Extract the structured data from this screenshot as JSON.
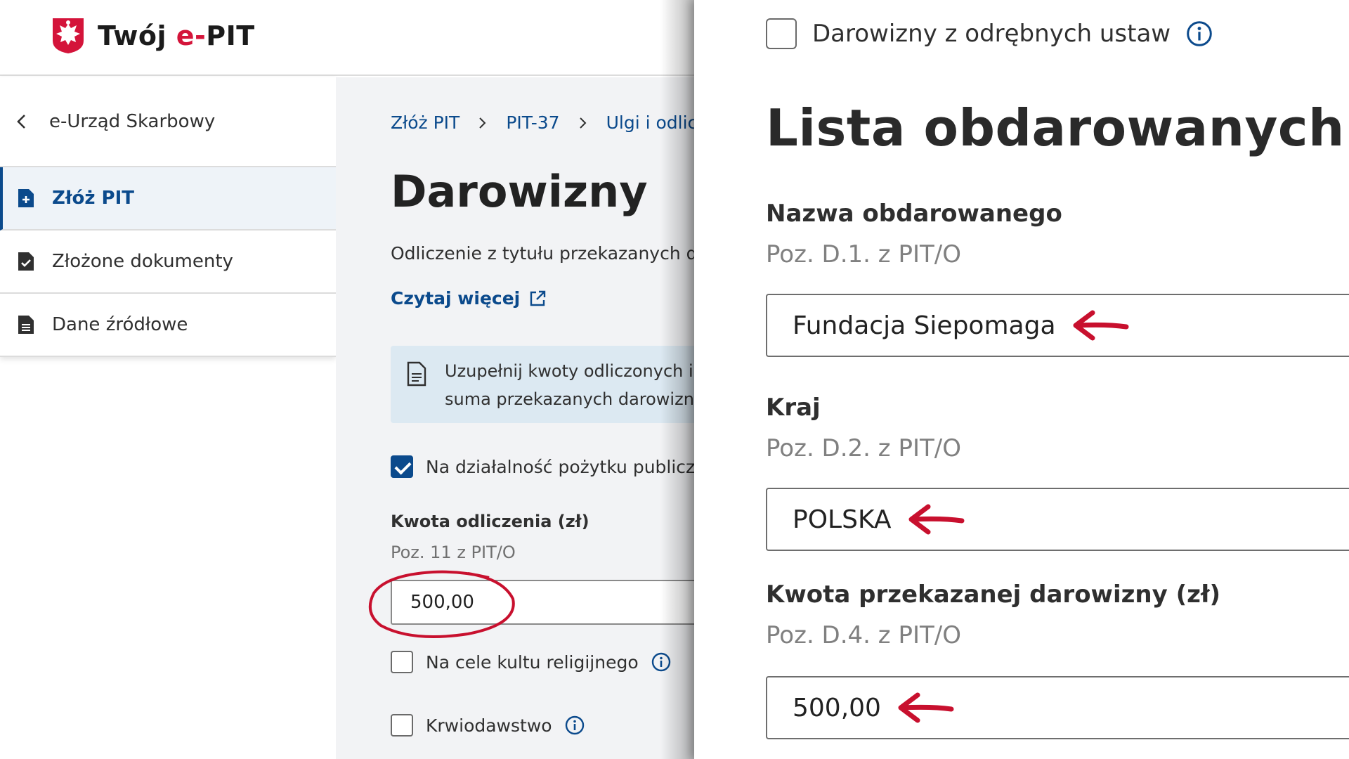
{
  "brand": {
    "name_prefix": "Twój ",
    "name_accent": "e-",
    "name_suffix": "PIT",
    "accent_color": "#d4143a"
  },
  "sidebar": {
    "back_label": "e-Urząd Skarbowy",
    "items": [
      {
        "label": "Złóż PIT",
        "active": true,
        "icon": "file-plus-icon"
      },
      {
        "label": "Złożone dokumenty",
        "active": false,
        "icon": "file-check-icon"
      },
      {
        "label": "Dane źródłowe",
        "active": false,
        "icon": "file-lines-icon"
      }
    ]
  },
  "main": {
    "breadcrumb": [
      "Złóż PIT",
      "PIT-37",
      "Ulgi i odlicz"
    ],
    "title": "Darowizny",
    "lead": "Odliczenie z tytułu przekazanych dar",
    "read_more": "Czytaj więcej",
    "info_lines": [
      "Uzupełnij kwoty odliczonych i",
      "suma przekazanych darowizn"
    ],
    "checks": {
      "public_benefit": {
        "label": "Na działalność pożytku publiczn",
        "checked": true
      },
      "religious": {
        "label": "Na cele kultu religijnego",
        "checked": false
      },
      "blood": {
        "label": "Krwiodawstwo",
        "checked": false
      }
    },
    "amount": {
      "label": "Kwota odliczenia (zł)",
      "sub": "Poz. 11 z PIT/O",
      "value": "500,00"
    }
  },
  "panel": {
    "top_check": {
      "label": "Darowizny z odrębnych ustaw",
      "checked": false
    },
    "title": "Lista obdarowanych",
    "fields": [
      {
        "label": "Nazwa obdarowanego",
        "sub": "Poz. D.1. z PIT/O",
        "value": "Fundacja Siepomaga"
      },
      {
        "label": "Kraj",
        "sub": "Poz. D.2. z PIT/O",
        "value": "POLSKA"
      },
      {
        "label": "Kwota przekazanej darowizny (zł)",
        "sub": "Poz. D.4. z PIT/O",
        "value": "500,00"
      }
    ]
  },
  "colors": {
    "primary": "#0b4a8c",
    "annotation_red": "#c8102e",
    "info_bg": "#dce9f2"
  }
}
